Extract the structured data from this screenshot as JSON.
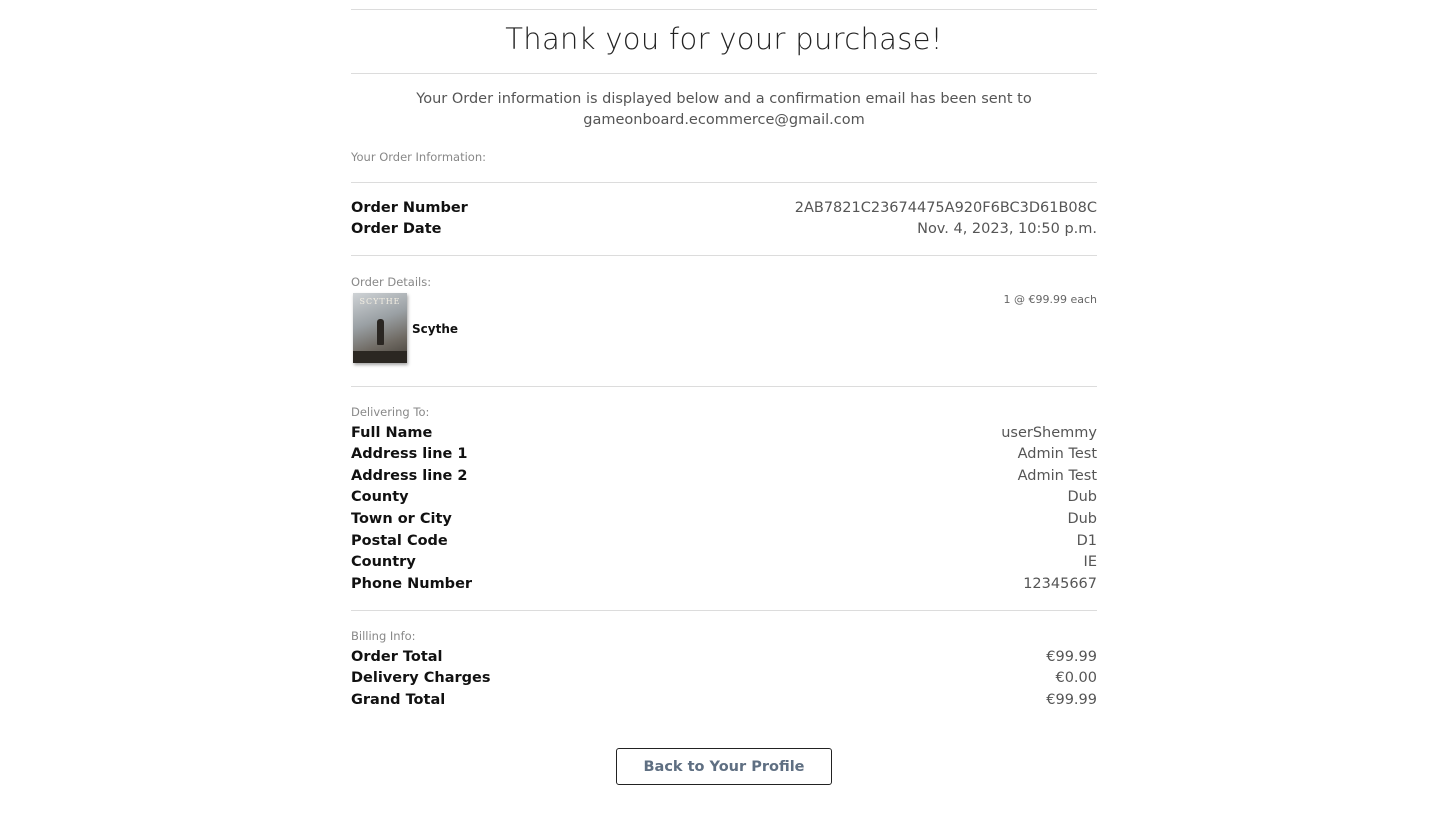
{
  "page": {
    "title": "Thank you for your purchase!",
    "intro_line1": "Your Order information is displayed below and a confirmation email has been sent to",
    "intro_line2": "gameonboard.ecommerce@gmail.com"
  },
  "order_info": {
    "label": "Your Order Information:",
    "rows": [
      {
        "key": "Order Number",
        "value": "2AB7821C23674475A920F6BC3D61B08C"
      },
      {
        "key": "Order Date",
        "value": "Nov. 4, 2023, 10:50 p.m."
      }
    ]
  },
  "order_details": {
    "label": "Order Details:",
    "item": {
      "name": "Scythe",
      "quantity_text": "1 @ €99.99 each",
      "image_title": "SCYTHE"
    }
  },
  "delivery": {
    "label": "Delivering To:",
    "rows": [
      {
        "key": "Full Name",
        "value": "userShemmy"
      },
      {
        "key": "Address line 1",
        "value": "Admin Test"
      },
      {
        "key": "Address line 2",
        "value": "Admin Test"
      },
      {
        "key": "County",
        "value": "Dub"
      },
      {
        "key": "Town or City",
        "value": "Dub"
      },
      {
        "key": "Postal Code",
        "value": "D1"
      },
      {
        "key": "Country",
        "value": "IE"
      },
      {
        "key": "Phone Number",
        "value": "12345667"
      }
    ]
  },
  "billing": {
    "label": "Billing Info:",
    "rows": [
      {
        "key": "Order Total",
        "value": "€99.99"
      },
      {
        "key": "Delivery Charges",
        "value": "€0.00"
      },
      {
        "key": "Grand Total",
        "value": "€99.99"
      }
    ]
  },
  "actions": {
    "back_button": "Back to Your Profile"
  }
}
